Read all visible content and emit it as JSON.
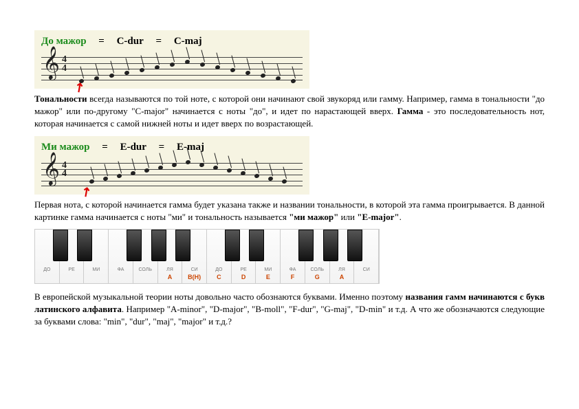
{
  "score1": {
    "keyName": "До мажор",
    "alt1": "C-dur",
    "alt2": "C-maj",
    "timeSig": {
      "top": "4",
      "bot": "4"
    }
  },
  "para1": {
    "lead": "Тональности",
    "text1": " всегда называются по той ноте, с которой они начинают свой звукоряд или гамму. Например, гамма в тональности \"до мажор\" или по-другому \"C-major\" начинается с ноты \"до\", и идет по нарастающей вверх. ",
    "lead2": "Гамма",
    "text2": " - это последовательность нот, которая начинается с самой нижней ноты и идет вверх по возрастающей."
  },
  "score2": {
    "keyName": "Ми мажор",
    "alt1": "E-dur",
    "alt2": "E-maj",
    "timeSig": {
      "top": "4",
      "bot": "4"
    }
  },
  "para2": {
    "text1": "Первая нота, с которой начинается гамма будет указана также и названии тональности, в которой эта гамма проигрывается. В данной картинке гамма начинается с ноты \"ми\" и тональность называется ",
    "bold1": "\"ми мажор\"",
    "mid": " или ",
    "bold2": "\"E-major\"",
    "tail": "."
  },
  "keyboard": {
    "whites": [
      {
        "ru": "ДО",
        "lt": "",
        "color": "#888"
      },
      {
        "ru": "РЕ",
        "lt": "",
        "color": "#888"
      },
      {
        "ru": "МИ",
        "lt": "",
        "color": "#888"
      },
      {
        "ru": "ФА",
        "lt": "",
        "color": "#888"
      },
      {
        "ru": "СОЛЬ",
        "lt": "",
        "color": "#888"
      },
      {
        "ru": "ЛЯ",
        "lt": "A",
        "color": "#c40"
      },
      {
        "ru": "СИ",
        "lt": "B(H)",
        "color": "#c40"
      },
      {
        "ru": "ДО",
        "lt": "C",
        "color": "#c40"
      },
      {
        "ru": "РЕ",
        "lt": "D",
        "color": "#c40"
      },
      {
        "ru": "МИ",
        "lt": "E",
        "color": "#c40"
      },
      {
        "ru": "ФА",
        "lt": "F",
        "color": "#c40"
      },
      {
        "ru": "СОЛЬ",
        "lt": "G",
        "color": "#c40"
      },
      {
        "ru": "ЛЯ",
        "lt": "A",
        "color": "#c40"
      },
      {
        "ru": "СИ",
        "lt": "",
        "color": "#888"
      }
    ],
    "blackPositions": [
      0,
      1,
      3,
      4,
      5,
      7,
      8,
      10,
      11,
      12
    ]
  },
  "para3": {
    "text1": "В европейской музыкальной теории ноты довольно часто обознаются буквами. Именно поэтому ",
    "bold1": "названия гамм начинаются с букв латинского алфавита",
    "text2": ". Например \"A-minor\", \"D-major\", \"B-moll\", \"F-dur\", \"G-maj\", \"D-min\" и т.д. А что же обозначаются следующие за буквами слова: \"min\", \"dur\", \"maj\", \"major\"  и т.д.?"
  }
}
